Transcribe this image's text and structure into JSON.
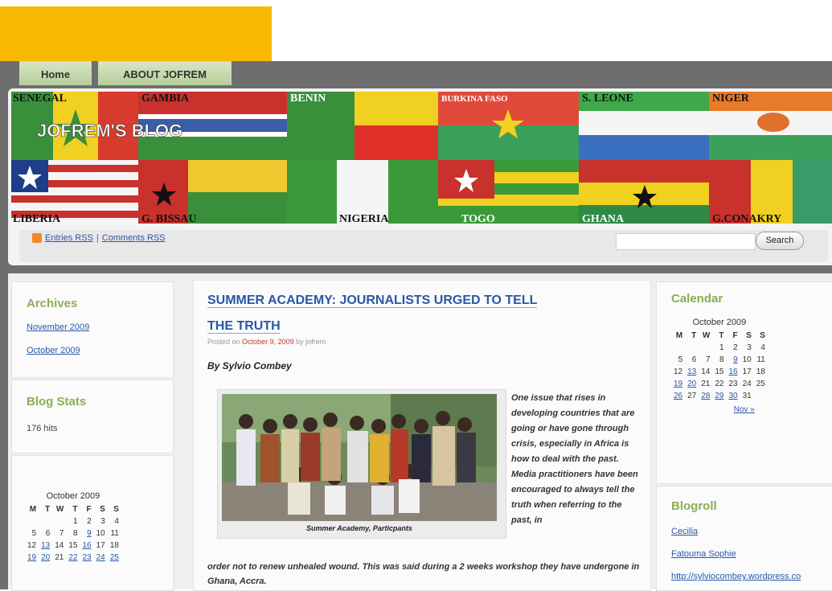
{
  "nav": {
    "home": "Home",
    "about": "ABOUT JOFREM"
  },
  "header": {
    "blog_title": "JOFREM'S BLOG",
    "flag_labels": [
      "SENEGAL",
      "GAMBIA",
      "BENIN",
      "BURKINA FASO",
      "S. LEONE",
      "NIGER",
      "LIBERIA",
      "G. BISSAU",
      "NIGERIA",
      "TOGO",
      "GHANA",
      "G.CONAKRY"
    ]
  },
  "rss": {
    "entries": "Entries RSS",
    "separator": "|",
    "comments": "Comments RSS"
  },
  "search": {
    "button": "Search",
    "value": ""
  },
  "left_sidebar": {
    "archives_title": "Archives",
    "archives": [
      "November 2009",
      "October 2009"
    ],
    "stats_title": "Blog Stats",
    "hits": "176 hits",
    "calendar": {
      "caption": "October 2009",
      "headers": [
        "M",
        "T",
        "W",
        "T",
        "F",
        "S",
        "S"
      ],
      "rows": [
        [
          "",
          "",
          "",
          "1",
          "2",
          "3",
          "4"
        ],
        [
          "5",
          "6",
          "7",
          "8",
          "9",
          "10",
          "11"
        ],
        [
          "12",
          "13",
          "14",
          "15",
          "16",
          "17",
          "18"
        ],
        [
          "19",
          "20",
          "21",
          "22",
          "23",
          "24",
          "25"
        ]
      ],
      "linked_days": [
        "9",
        "13",
        "16",
        "19",
        "20",
        "22",
        "23",
        "24",
        "25"
      ]
    }
  },
  "post": {
    "title_line1": "SUMMER ACADEMY: JOURNALISTS URGED TO TELL",
    "title_line2": "THE TRUTH",
    "meta_prefix": "Posted on",
    "meta_date": "October 9, 2009",
    "meta_by": "by jofrem",
    "byline": "By Sylvio Combey",
    "photo_caption": "Summer Academy, Particpants",
    "side_text": "One issue that rises in developing countries that are going or have gone through crisis, especially in Africa is how to deal with the past. Media practitioners have been encouraged to always tell the truth when referring to the past, in",
    "body_text": "order not to renew unhealed wound. This was said during a 2 weeks workshop they have undergone in Ghana, Accra."
  },
  "right_sidebar": {
    "calendar_title": "Calendar",
    "calendar": {
      "caption": "October 2009",
      "headers": [
        "M",
        "T",
        "W",
        "T",
        "F",
        "S",
        "S"
      ],
      "rows": [
        [
          "",
          "",
          "",
          "1",
          "2",
          "3",
          "4"
        ],
        [
          "5",
          "6",
          "7",
          "8",
          "9",
          "10",
          "11"
        ],
        [
          "12",
          "13",
          "14",
          "15",
          "16",
          "17",
          "18"
        ],
        [
          "19",
          "20",
          "21",
          "22",
          "23",
          "24",
          "25"
        ],
        [
          "26",
          "27",
          "28",
          "29",
          "30",
          "31",
          ""
        ]
      ],
      "linked_days": [
        "9",
        "13",
        "16",
        "19",
        "20",
        "26",
        "28",
        "29",
        "30"
      ],
      "next": "Nov »"
    },
    "blogroll_title": "Blogroll",
    "blogroll": [
      "Cecilia",
      "Fatouma Sophie",
      "http://sylviocombey.wordpress.co"
    ]
  },
  "colors": {
    "accent_gold": "#f9b800",
    "link_blue": "#2a57a8",
    "widget_green": "#8bad57",
    "nav_green": "#c4d9aa"
  }
}
